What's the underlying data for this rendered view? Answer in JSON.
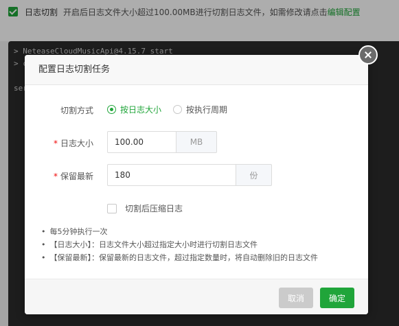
{
  "background": {
    "option_label": "日志切割",
    "option_desc": "开启后日志文件大小超过100.00MB进行切割日志文件，如需修改请点击",
    "option_link": "编辑配置",
    "terminal_lines": [
      "> NeteaseCloudMusicApi@4.15.7 start",
      "> c",
      "ser"
    ]
  },
  "dialog": {
    "title": "配置日志切割任务",
    "cut_mode_label": "切割方式",
    "cut_mode_options": [
      "按日志大小",
      "按执行周期"
    ],
    "cut_mode_selected": "按日志大小",
    "log_size_label": "日志大小",
    "log_size_value": "100.00",
    "log_size_unit": "MB",
    "keep_latest_label": "保留最新",
    "keep_latest_value": "180",
    "keep_latest_unit": "份",
    "compress_label": "切割后压缩日志",
    "compress_checked": false,
    "notes": [
      "每5分钟执行一次",
      "【日志大小】：日志文件大小超过指定大小时进行切割日志文件",
      "【保留最新】：保留最新的日志文件，超过指定数量时，将自动删除旧的日志文件"
    ],
    "cancel_label": "取消",
    "ok_label": "确定"
  },
  "colors": {
    "accent": "#20a53a",
    "required": "#ef0808",
    "overlay": "rgba(0,0,0,0.32)"
  },
  "icons": [
    "check-icon",
    "close-icon",
    "radio-icon",
    "checkbox-icon"
  ]
}
